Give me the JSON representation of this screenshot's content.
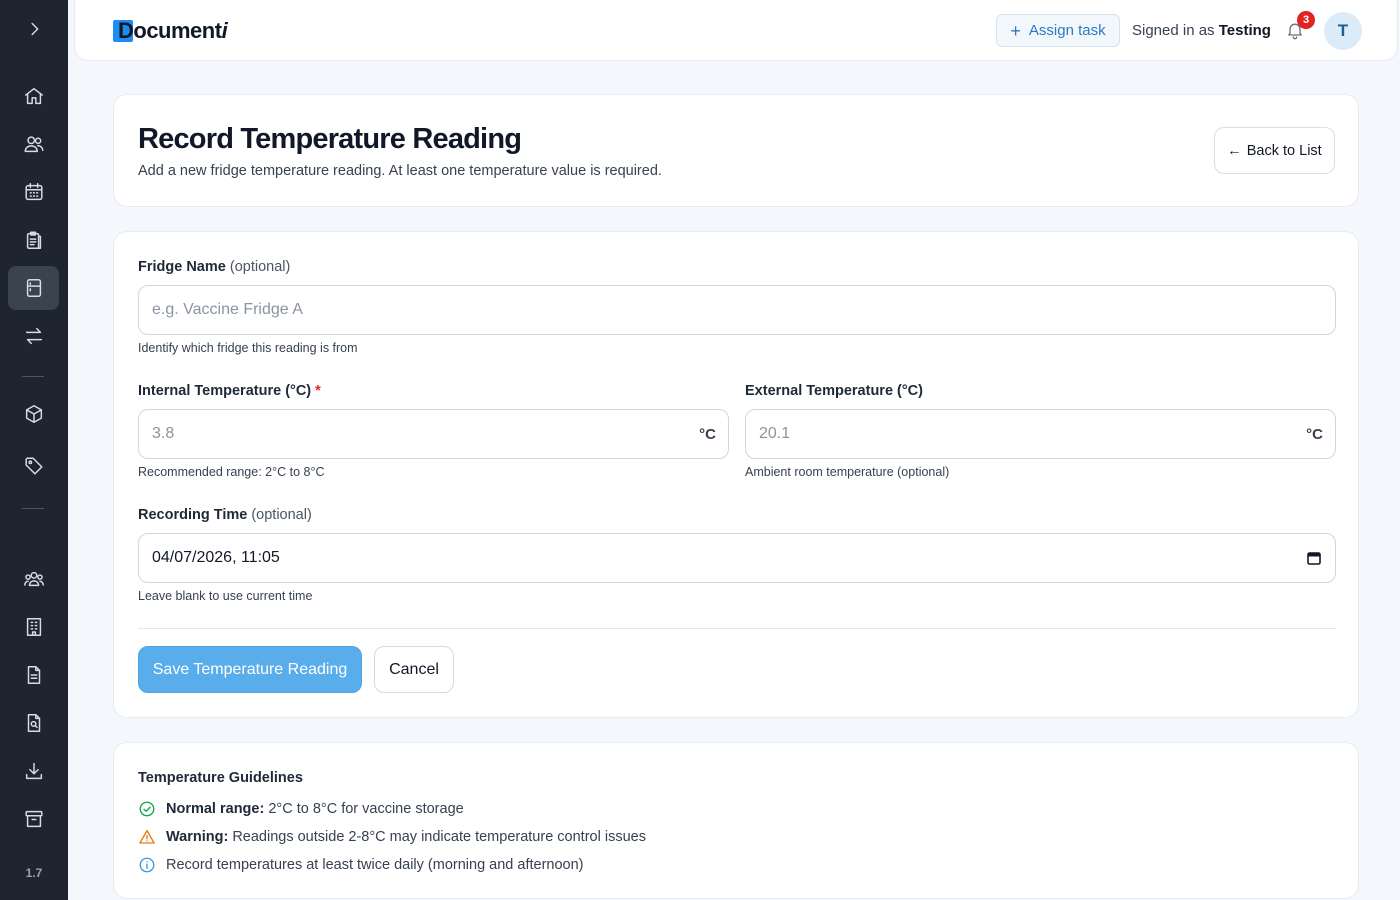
{
  "app": {
    "logo_text_main": "Document",
    "logo_text_tail": "i",
    "version": "1.7"
  },
  "sidebar": {
    "items": [
      {
        "icon": "chevron-right-icon"
      },
      {
        "icon": "home-icon"
      },
      {
        "icon": "users-icon"
      },
      {
        "icon": "calendar-icon"
      },
      {
        "icon": "clipboard-icon"
      },
      {
        "icon": "fridge-icon",
        "active": true
      },
      {
        "icon": "transfer-icon"
      },
      {
        "icon": "box-icon"
      },
      {
        "icon": "tag-icon"
      },
      {
        "icon": "team-icon"
      },
      {
        "icon": "building-icon"
      },
      {
        "icon": "file-text-icon"
      },
      {
        "icon": "file-search-icon"
      },
      {
        "icon": "download-icon"
      },
      {
        "icon": "archive-icon"
      }
    ]
  },
  "header": {
    "assign_task_label": "Assign task",
    "signed_in_prefix": "Signed in as",
    "username": "Testing",
    "notification_count": "3",
    "avatar_initial": "T"
  },
  "page": {
    "title": "Record Temperature Reading",
    "subtitle": "Add a new fridge temperature reading. At least one temperature value is required.",
    "back_label": "Back to List"
  },
  "form": {
    "fridge_name": {
      "label": "Fridge Name",
      "optional": "(optional)",
      "placeholder": "e.g. Vaccine Fridge A",
      "help": "Identify which fridge this reading is from"
    },
    "internal_temp": {
      "label": "Internal Temperature (°C)",
      "required_mark": "*",
      "placeholder": "3.8",
      "unit": "°C",
      "help": "Recommended range: 2°C to 8°C"
    },
    "external_temp": {
      "label": "External Temperature (°C)",
      "placeholder": "20.1",
      "unit": "°C",
      "help": "Ambient room temperature (optional)"
    },
    "recording_time": {
      "label": "Recording Time",
      "optional": "(optional)",
      "value": "04/07/2026, 11:05",
      "help": "Leave blank to use current time"
    },
    "save_label": "Save Temperature Reading",
    "cancel_label": "Cancel"
  },
  "guidelines": {
    "title": "Temperature Guidelines",
    "items": [
      {
        "icon": "check-circle-icon",
        "bold": "Normal range:",
        "text": "2°C to 8°C for vaccine storage",
        "color": "#16a34a"
      },
      {
        "icon": "warning-icon",
        "bold": "Warning:",
        "text": "Readings outside 2-8°C may indicate temperature control issues",
        "color": "#ea7a14"
      },
      {
        "icon": "info-icon",
        "bold": "",
        "text": "Record temperatures at least twice daily (morning and afternoon)",
        "color": "#3b9ae1"
      }
    ]
  },
  "colors": {
    "sidebar_bg": "#1e2530",
    "accent": "#58adea",
    "brand": "#1d8cf0",
    "danger": "#e02424"
  }
}
